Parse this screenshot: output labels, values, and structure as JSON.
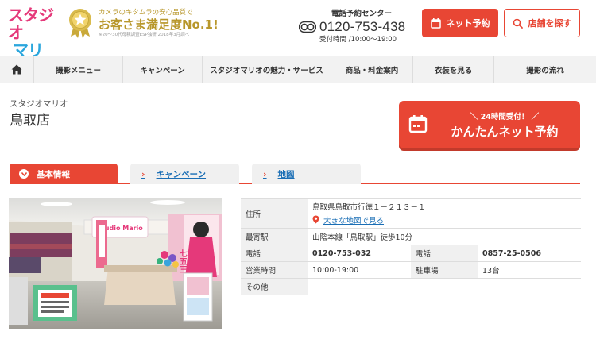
{
  "header": {
    "logo_line1": "スタジオ",
    "logo_line2": "マリオ",
    "tagline_top": "カメラのキタムラの安心品質で",
    "tagline_main": "お客さま満足度No.1!",
    "tagline_note": "※20～30代母親調査ESP独研 2018年3月調べ",
    "phone_label": "電話予約センター",
    "phone_number": "0120-753-438",
    "phone_hours": "受付時間 /10:00～19:00",
    "net_reserve_label": "ネット予約",
    "find_store_label": "店舗を探す"
  },
  "nav": {
    "items": [
      "撮影メニュー",
      "キャンペーン",
      "スタジオマリオの魅力・サービス",
      "商品・料金案内",
      "衣装を見る",
      "撮影の流れ"
    ]
  },
  "store": {
    "brand": "スタジオマリオ",
    "name": "鳥取店"
  },
  "cta": {
    "top": "＼ 24時間受付！ ／",
    "main": "かんたんネット予約"
  },
  "tabs": [
    {
      "label": "基本情報",
      "active": true
    },
    {
      "label": "キャンペーン",
      "active": false
    },
    {
      "label": "地図",
      "active": false
    }
  ],
  "info": {
    "address_label": "住所",
    "address": "鳥取県鳥取市行徳１－２１３－１",
    "map_link": "大きな地図で見る",
    "station_label": "最寄駅",
    "station": "山陰本線「鳥取駅」徒歩10分",
    "tel1_label": "電話",
    "tel1": "0120-753-032",
    "tel2_label": "電話",
    "tel2": "0857-25-0506",
    "hours_label": "営業時間",
    "hours": "10:00-19:00",
    "parking_label": "駐車場",
    "parking": "13台",
    "other_label": "その他",
    "other": ""
  },
  "photo": {
    "sign_text": "Studio Mario",
    "banner_text": "七五三"
  },
  "colors": {
    "accent": "#e84634",
    "link": "#1a6eb5",
    "gold": "#b8972b",
    "logo_pink": "#e5397a",
    "logo_blue": "#2aa6dd"
  }
}
